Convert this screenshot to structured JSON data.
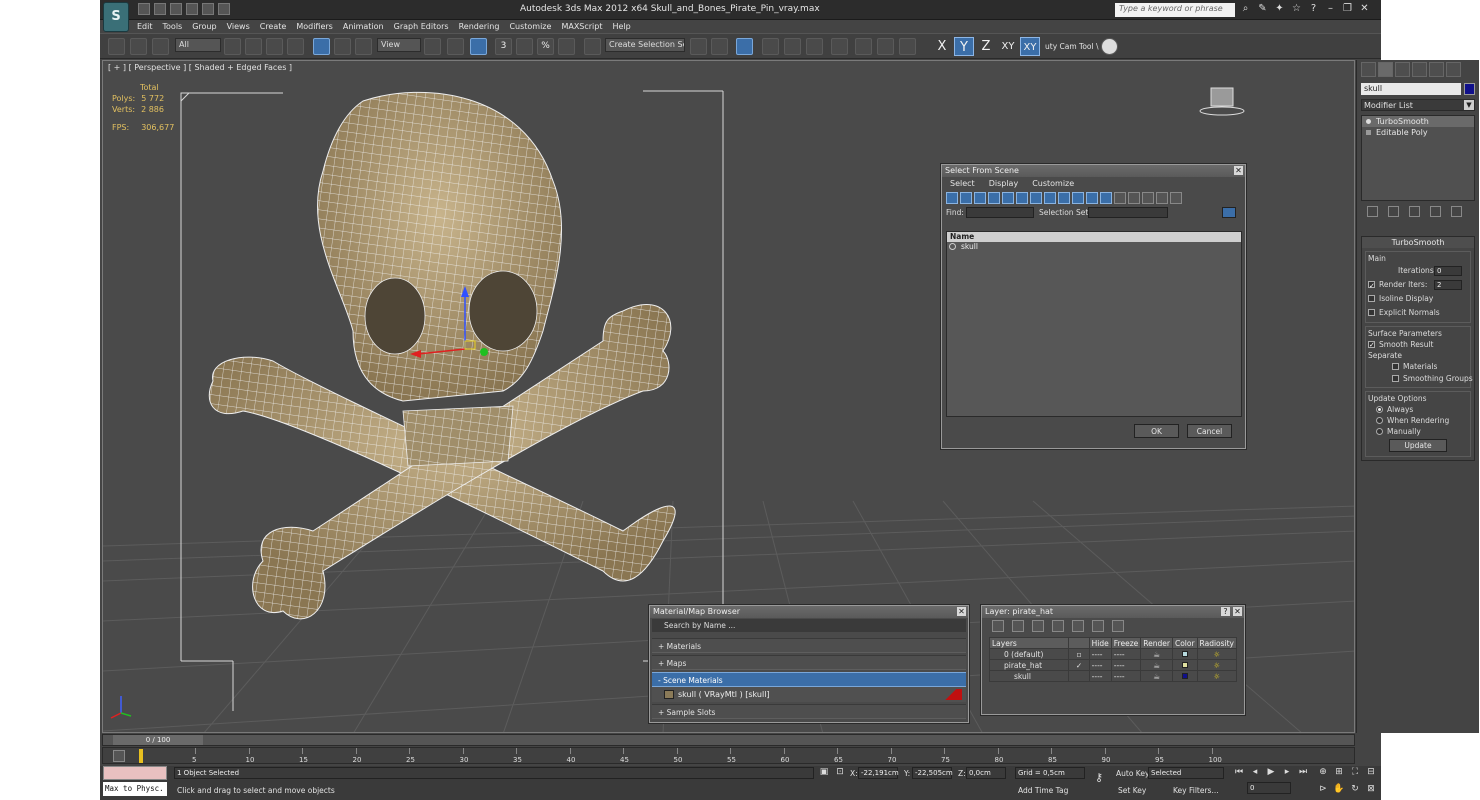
{
  "window": {
    "title": "Autodesk 3ds Max  2012 x64     Skull_and_Bones_Pirate_Pin_vray.max",
    "app_icon": "3ds-max-logo-icon",
    "search_placeholder": "Type a keyword or phrase"
  },
  "menu": [
    "Edit",
    "Tools",
    "Group",
    "Views",
    "Create",
    "Modifiers",
    "Animation",
    "Graph Editors",
    "Rendering",
    "Customize",
    "MAXScript",
    "Help"
  ],
  "toolbar": {
    "filter_value": "All",
    "ref_coord": "View",
    "snap_label": "3",
    "angle_snap": "%",
    "selection_set_placeholder": "Create Selection Se",
    "axis_buttons": [
      "X",
      "Y",
      "Z",
      "XY",
      "XY"
    ],
    "active_axis": "Y",
    "extra_label": "uty Cam Tool \\"
  },
  "viewport": {
    "label": "[ + ] [ Perspective ] [ Shaded + Edged Faces ]",
    "stats_header": "Total",
    "stats": [
      {
        "label": "Polys:",
        "value": "5 772"
      },
      {
        "label": "Verts:",
        "value": "2 886"
      }
    ],
    "fps_label": "FPS:",
    "fps_value": "306,677"
  },
  "command_panel": {
    "object_name": "skull",
    "object_color": "#10108a",
    "modifier_list": "Modifier List",
    "stack": [
      "TurboSmooth",
      "Editable Poly"
    ],
    "turbosmooth": {
      "title": "TurboSmooth",
      "main_label": "Main",
      "iterations_label": "Iterations:",
      "iterations": "0",
      "render_iters_label": "Render Iters:",
      "render_iters": "2",
      "isoline": "Isoline Display",
      "explicit": "Explicit Normals",
      "surface_label": "Surface Parameters",
      "smooth_result": "Smooth Result",
      "separate_label": "Separate",
      "materials": "Materials",
      "smoothing_groups": "Smoothing Groups",
      "update_label": "Update Options",
      "always": "Always",
      "when_rendering": "When Rendering",
      "manually": "Manually",
      "update_btn": "Update"
    }
  },
  "select_dialog": {
    "title": "Select From Scene",
    "menu": [
      "Select",
      "Display",
      "Customize"
    ],
    "find_label": "Find:",
    "selset_label": "Selection Set:",
    "column": "Name",
    "items": [
      "skull"
    ],
    "ok": "OK",
    "cancel": "Cancel"
  },
  "material_browser": {
    "title": "Material/Map Browser",
    "search": "Search by Name ...",
    "sections": [
      "+ Materials",
      "+ Maps",
      "- Scene Materials"
    ],
    "scene_item": "skull  ( VRayMtl ) [skull]",
    "sample": "+ Sample Slots"
  },
  "layer_dialog": {
    "title": "Layer: pirate_hat",
    "headers": [
      "Layers",
      "",
      "Hide",
      "Freeze",
      "Render",
      "Color",
      "Radiosity"
    ],
    "rows": [
      {
        "name": "0 (default)",
        "hide": "----",
        "freeze": "----",
        "color": "#b8dbe0"
      },
      {
        "name": "pirate_hat",
        "hide": "----",
        "freeze": "----",
        "color": "#e0e0a0"
      },
      {
        "name": "skull",
        "hide": "----",
        "freeze": "----",
        "color": "#10108a"
      }
    ]
  },
  "timeline": {
    "frame": "0 / 100",
    "ticks": [
      "5",
      "10",
      "15",
      "20",
      "25",
      "30",
      "35",
      "40",
      "45",
      "50",
      "55",
      "60",
      "65",
      "70",
      "75",
      "80",
      "85",
      "90",
      "95",
      "100"
    ]
  },
  "status": {
    "selected": "1 Object Selected",
    "prompt": "Click and drag to select and move objects",
    "listener": "Max to Physc.",
    "x_label": "X:",
    "x": "-22,191cm",
    "y_label": "Y:",
    "y": "-22,505cm",
    "z_label": "Z:",
    "z": "0,0cm",
    "grid": "Grid = 0,5cm",
    "add_time_tag": "Add Time Tag",
    "auto_key": "Auto Key",
    "set_key": "Set Key",
    "key_mode": "Selected",
    "key_filters": "Key Filters...",
    "frame_field": "0"
  }
}
